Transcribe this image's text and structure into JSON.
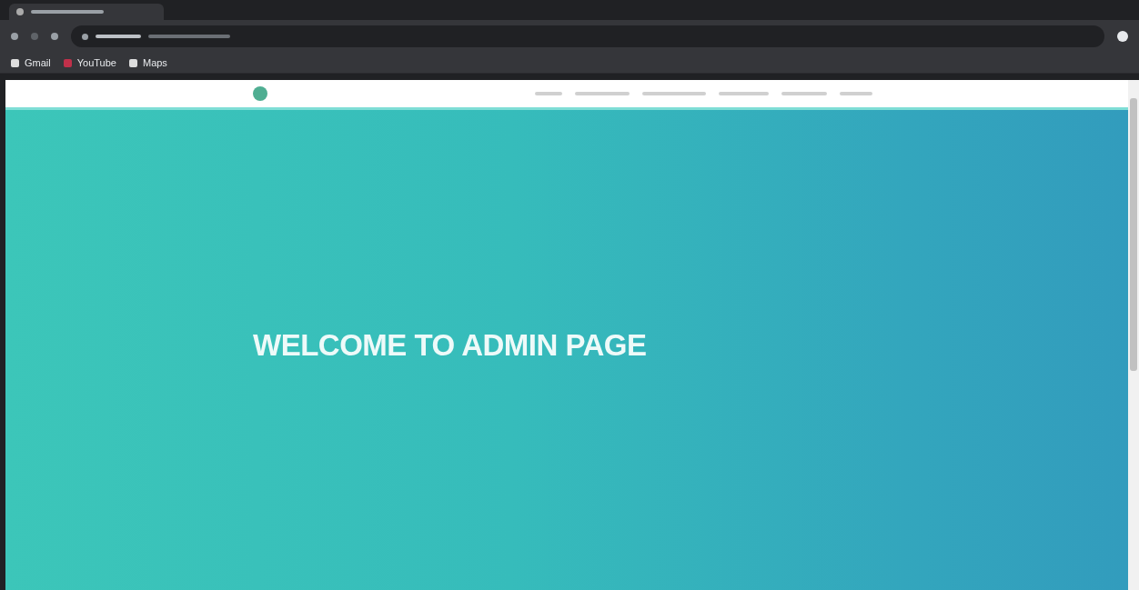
{
  "browser": {
    "bookmarks": [
      {
        "label": "Gmail",
        "color": "#dddddd"
      },
      {
        "label": "YouTube",
        "color": "#c0304a"
      },
      {
        "label": "Maps",
        "color": "#dddddd"
      }
    ]
  },
  "hero": {
    "title": "WELCOME TO ADMIN PAGE"
  }
}
